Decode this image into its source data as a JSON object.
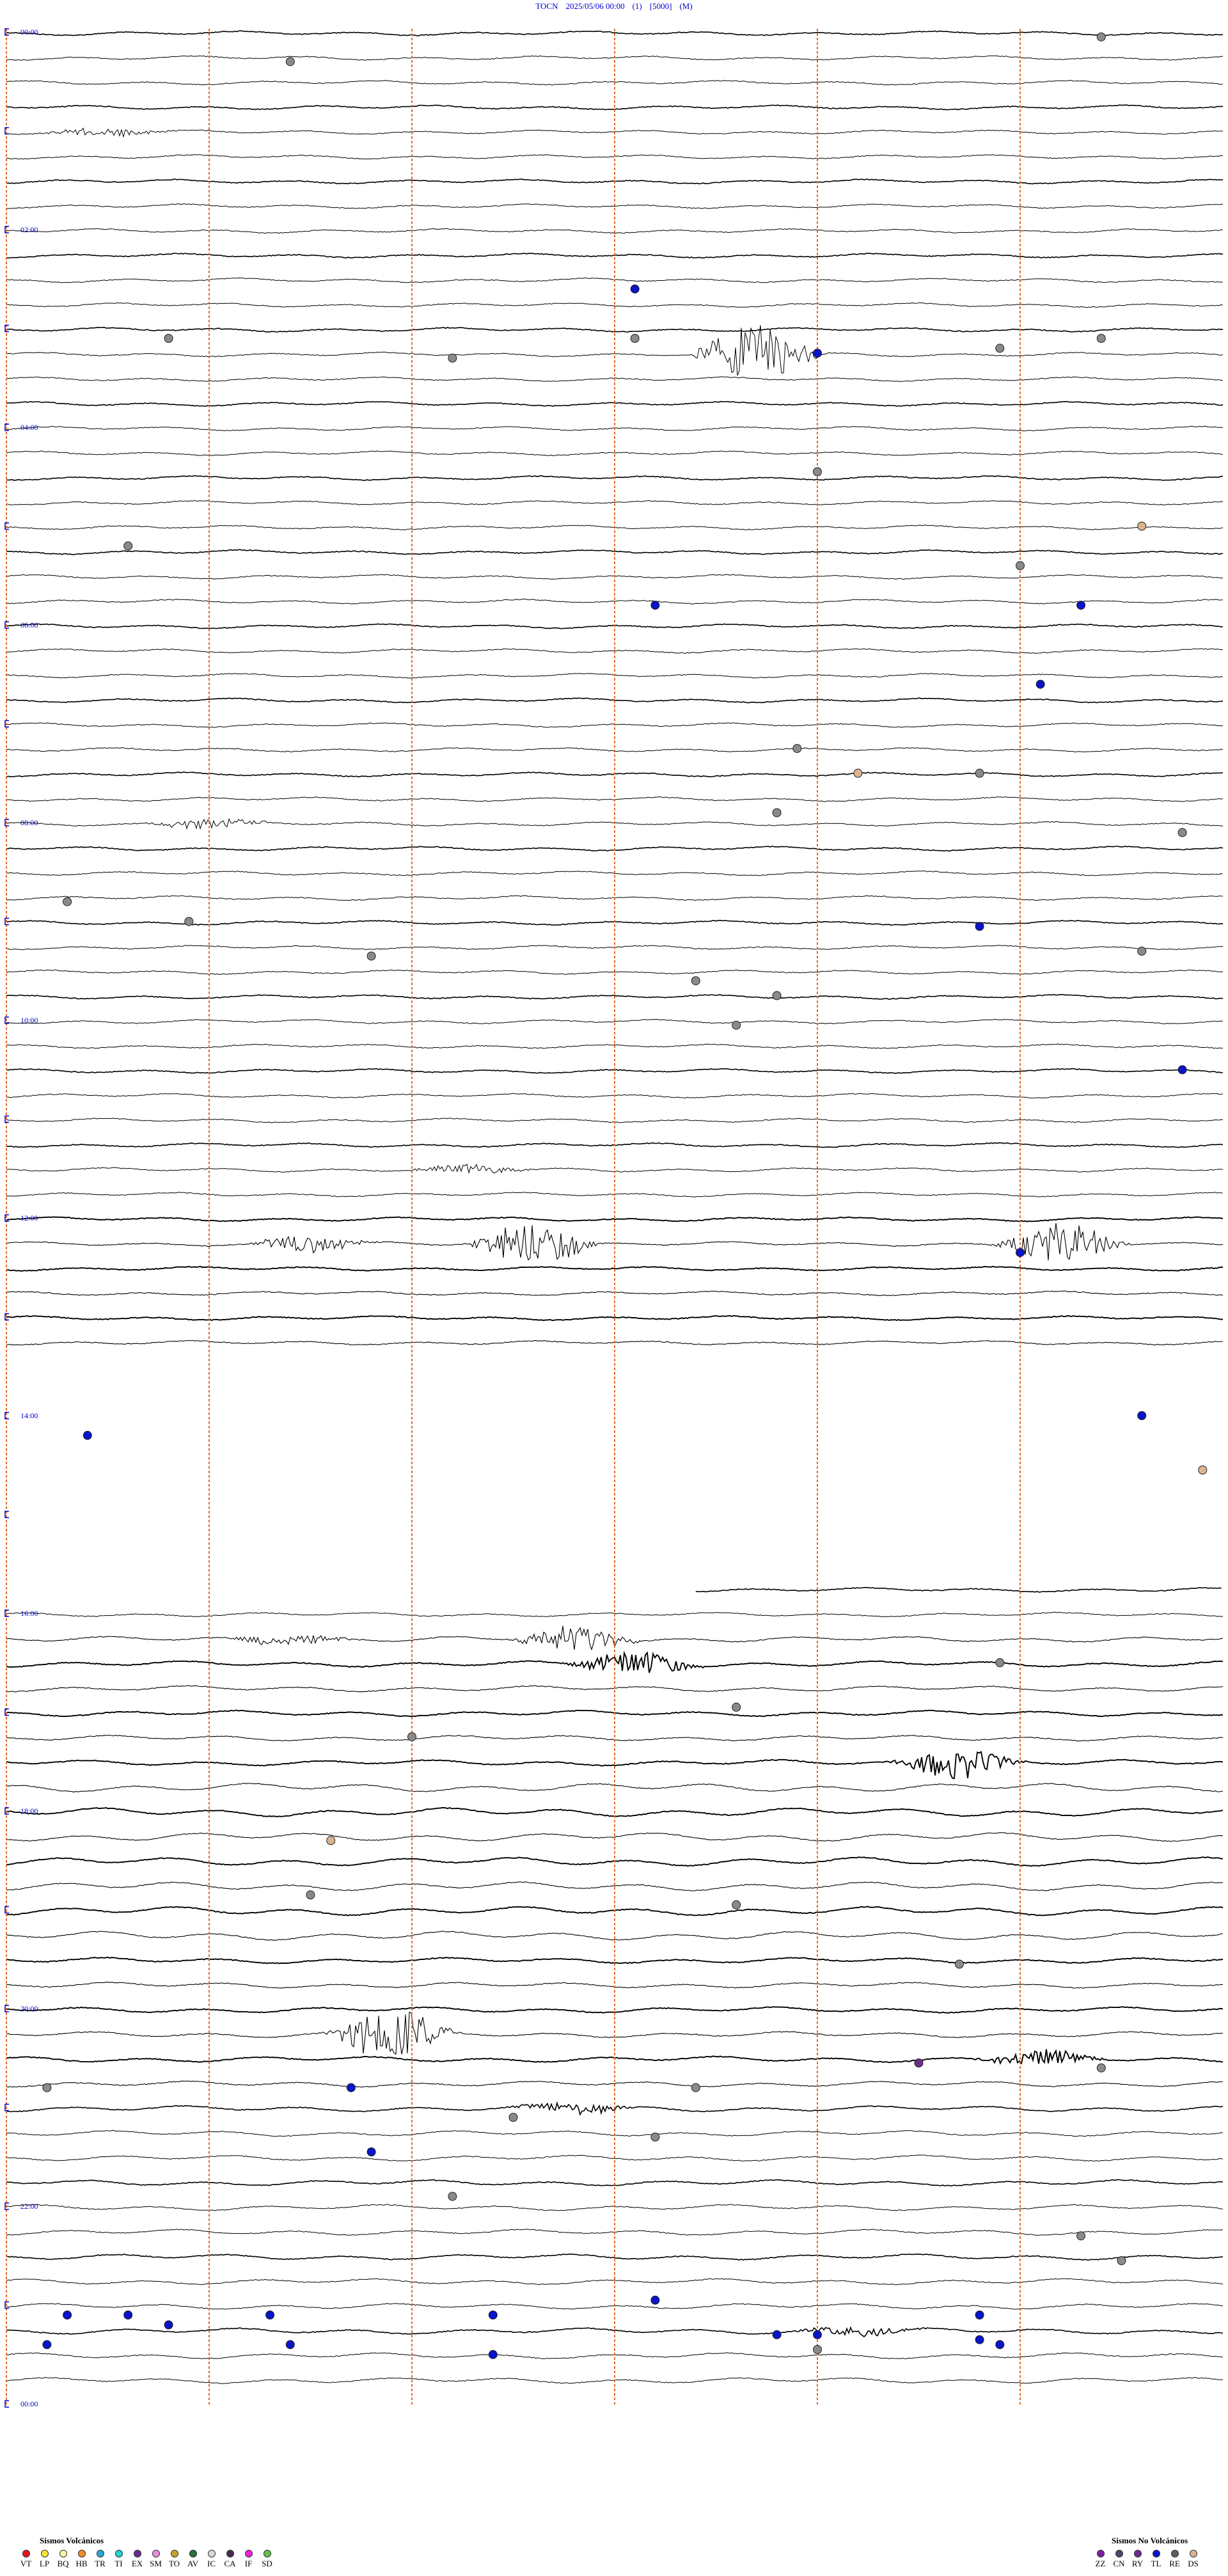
{
  "header": {
    "station": "TOCN",
    "datetime": "2025/05/06 00:00",
    "component": "(1)",
    "gain": "[5000]",
    "mode": "(M)"
  },
  "chart_data": {
    "type": "seismogram-helicorder",
    "time_labels": [
      "00:00",
      "02:00",
      "04:00",
      "06:00",
      "08:00",
      "10:00",
      "12:00",
      "14:00",
      "16:00",
      "18:00",
      "20:00",
      "22:00",
      "00:00"
    ],
    "lines_per_hour": 4,
    "minute_grid": [
      0,
      10,
      20,
      30,
      40,
      50
    ],
    "gap": {
      "start_hour": 13.5,
      "end_hour": 16.0
    },
    "events": [
      {
        "hour": 0.05,
        "minute": 54,
        "type": "IC"
      },
      {
        "hour": 0.3,
        "minute": 14,
        "type": "IC"
      },
      {
        "hour": 2.6,
        "minute": 31,
        "type": "TL"
      },
      {
        "hour": 3.1,
        "minute": 8,
        "type": "IC"
      },
      {
        "hour": 3.1,
        "minute": 31,
        "type": "IC"
      },
      {
        "hour": 3.25,
        "minute": 40,
        "type": "TL"
      },
      {
        "hour": 3.2,
        "minute": 49,
        "type": "IC"
      },
      {
        "hour": 3.1,
        "minute": 54,
        "type": "IC"
      },
      {
        "hour": 3.3,
        "minute": 22,
        "type": "IC"
      },
      {
        "hour": 4.45,
        "minute": 40,
        "type": "IC"
      },
      {
        "hour": 5.0,
        "minute": 56,
        "type": "DS"
      },
      {
        "hour": 5.2,
        "minute": 6,
        "type": "IC"
      },
      {
        "hour": 5.4,
        "minute": 50,
        "type": "IC"
      },
      {
        "hour": 5.8,
        "minute": 32,
        "type": "TL"
      },
      {
        "hour": 5.8,
        "minute": 53,
        "type": "TL"
      },
      {
        "hour": 6.6,
        "minute": 51,
        "type": "TL"
      },
      {
        "hour": 7.25,
        "minute": 39,
        "type": "IC"
      },
      {
        "hour": 7.5,
        "minute": 42,
        "type": "DS"
      },
      {
        "hour": 7.5,
        "minute": 48,
        "type": "IC"
      },
      {
        "hour": 7.9,
        "minute": 38,
        "type": "IC"
      },
      {
        "hour": 8.1,
        "minute": 58,
        "type": "IC"
      },
      {
        "hour": 8.8,
        "minute": 3,
        "type": "IC"
      },
      {
        "hour": 9.0,
        "minute": 9,
        "type": "IC"
      },
      {
        "hour": 9.05,
        "minute": 48,
        "type": "TL"
      },
      {
        "hour": 9.3,
        "minute": 56,
        "type": "IC"
      },
      {
        "hour": 9.35,
        "minute": 18,
        "type": "IC"
      },
      {
        "hour": 9.6,
        "minute": 34,
        "type": "IC"
      },
      {
        "hour": 9.75,
        "minute": 38,
        "type": "IC"
      },
      {
        "hour": 10.05,
        "minute": 36,
        "type": "IC"
      },
      {
        "hour": 10.5,
        "minute": 58,
        "type": "TL"
      },
      {
        "hour": 12.35,
        "minute": 50,
        "type": "TL"
      },
      {
        "hour": 14.0,
        "minute": 56,
        "type": "TL"
      },
      {
        "hour": 14.2,
        "minute": 4,
        "type": "TL"
      },
      {
        "hour": 14.55,
        "minute": 59,
        "type": "DS"
      },
      {
        "hour": 16.5,
        "minute": 49,
        "type": "IC"
      },
      {
        "hour": 16.95,
        "minute": 36,
        "type": "IC"
      },
      {
        "hour": 17.25,
        "minute": 20,
        "type": "IC"
      },
      {
        "hour": 18.3,
        "minute": 16,
        "type": "DS"
      },
      {
        "hour": 18.85,
        "minute": 15,
        "type": "IC"
      },
      {
        "hour": 18.95,
        "minute": 36,
        "type": "IC"
      },
      {
        "hour": 19.55,
        "minute": 47,
        "type": "IC"
      },
      {
        "hour": 20.55,
        "minute": 45,
        "type": "RY"
      },
      {
        "hour": 20.6,
        "minute": 54,
        "type": "IC"
      },
      {
        "hour": 20.8,
        "minute": 17,
        "type": "TL"
      },
      {
        "hour": 20.8,
        "minute": 34,
        "type": "IC"
      },
      {
        "hour": 20.8,
        "minute": 2,
        "type": "IC"
      },
      {
        "hour": 21.1,
        "minute": 25,
        "type": "IC"
      },
      {
        "hour": 21.3,
        "minute": 32,
        "type": "IC"
      },
      {
        "hour": 21.45,
        "minute": 18,
        "type": "TL"
      },
      {
        "hour": 21.9,
        "minute": 22,
        "type": "IC"
      },
      {
        "hour": 22.3,
        "minute": 53,
        "type": "IC"
      },
      {
        "hour": 22.55,
        "minute": 55,
        "type": "IC"
      },
      {
        "hour": 22.95,
        "minute": 32,
        "type": "TL"
      },
      {
        "hour": 23.1,
        "minute": 3,
        "type": "TL"
      },
      {
        "hour": 23.1,
        "minute": 6,
        "type": "TL"
      },
      {
        "hour": 23.1,
        "minute": 13,
        "type": "TL"
      },
      {
        "hour": 23.1,
        "minute": 24,
        "type": "TL"
      },
      {
        "hour": 23.2,
        "minute": 8,
        "type": "TL"
      },
      {
        "hour": 23.4,
        "minute": 2,
        "type": "TL"
      },
      {
        "hour": 23.4,
        "minute": 14,
        "type": "TL"
      },
      {
        "hour": 23.5,
        "minute": 24,
        "type": "TL"
      },
      {
        "hour": 23.3,
        "minute": 40,
        "type": "TL"
      },
      {
        "hour": 23.1,
        "minute": 48,
        "type": "TL"
      },
      {
        "hour": 23.35,
        "minute": 48,
        "type": "TL"
      },
      {
        "hour": 23.4,
        "minute": 49,
        "type": "TL"
      },
      {
        "hour": 23.45,
        "minute": 40,
        "type": "IC"
      },
      {
        "hour": 23.3,
        "minute": 38,
        "type": "TL"
      }
    ],
    "bursts": [
      {
        "hour": 1.0,
        "minute": 5,
        "amp": 0.5
      },
      {
        "hour": 3.25,
        "minute": 37,
        "amp": 3.2
      },
      {
        "hour": 8.0,
        "minute": 10,
        "amp": 0.6
      },
      {
        "hour": 11.4,
        "minute": 23,
        "amp": 0.5
      },
      {
        "hour": 12.25,
        "minute": 15,
        "amp": 0.9
      },
      {
        "hour": 12.25,
        "minute": 26,
        "amp": 2.4
      },
      {
        "hour": 12.25,
        "minute": 52,
        "amp": 2.2
      },
      {
        "hour": 16.35,
        "minute": 14,
        "amp": 0.6
      },
      {
        "hour": 16.35,
        "minute": 28,
        "amp": 1.5
      },
      {
        "hour": 16.6,
        "minute": 31,
        "amp": 1.4
      },
      {
        "hour": 17.45,
        "minute": 47,
        "amp": 1.6
      },
      {
        "hour": 20.25,
        "minute": 19,
        "amp": 2.8
      },
      {
        "hour": 20.45,
        "minute": 51,
        "amp": 0.9
      },
      {
        "hour": 21.0,
        "minute": 28,
        "amp": 0.6
      },
      {
        "hour": 23.25,
        "minute": 42,
        "amp": 0.5
      }
    ]
  },
  "legend": {
    "volcanic": {
      "title": "Sismos Volcánicos",
      "items": [
        {
          "code": "VT",
          "color": "#e8141b"
        },
        {
          "code": "LP",
          "color": "#f7e43a"
        },
        {
          "code": "BQ",
          "color": "#f7f7a6"
        },
        {
          "code": "HB",
          "color": "#f28c28"
        },
        {
          "code": "TR",
          "color": "#2aa7d9"
        },
        {
          "code": "TI",
          "color": "#22d3d3"
        },
        {
          "code": "EX",
          "color": "#6a2c8a"
        },
        {
          "code": "SM",
          "color": "#e98fd8"
        },
        {
          "code": "TO",
          "color": "#c9a227"
        },
        {
          "code": "AV",
          "color": "#2e6e3a"
        },
        {
          "code": "IC",
          "color": "#d8d8d8"
        },
        {
          "code": "CA",
          "color": "#4a2a55"
        },
        {
          "code": "IF",
          "color": "#f21ee0"
        },
        {
          "code": "SD",
          "color": "#63c04b"
        }
      ]
    },
    "nonvolcanic": {
      "title": "Sismos No Volcánicos",
      "items": [
        {
          "code": "ZZ",
          "color": "#7a1fa3"
        },
        {
          "code": "CN",
          "color": "#4a4a6a"
        },
        {
          "code": "RY",
          "color": "#6a2e8a"
        },
        {
          "code": "TL",
          "color": "#0a14c8"
        },
        {
          "code": "RE",
          "color": "#606060"
        },
        {
          "code": "DS",
          "color": "#d9b48f"
        }
      ]
    }
  },
  "event_colors": {
    "IC": "#8a8a8a",
    "TL": "#0a14c8",
    "DS": "#d9b48f",
    "RY": "#6a2e8a"
  }
}
